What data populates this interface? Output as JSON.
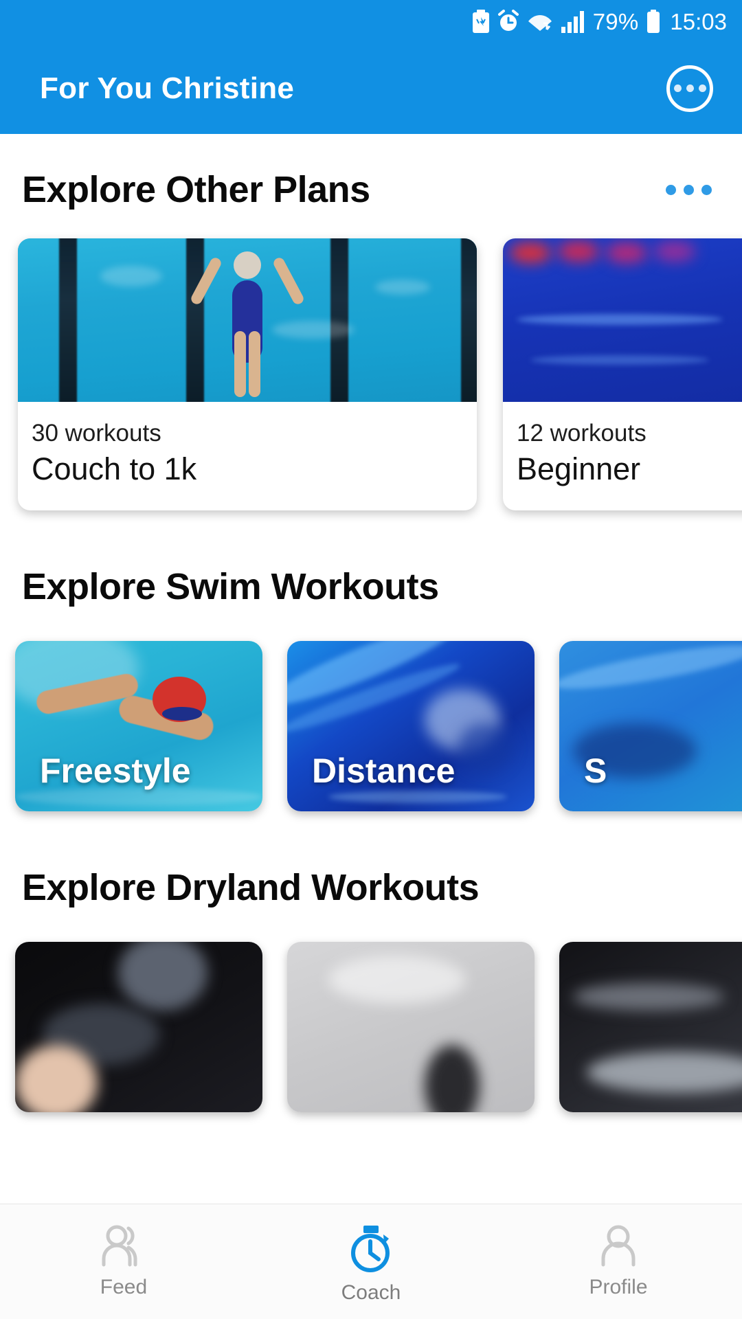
{
  "status_bar": {
    "battery_percent": "79%",
    "time": "15:03",
    "icons": [
      "battery-saver-icon",
      "alarm-icon",
      "wifi-icon",
      "signal-icon",
      "battery-icon"
    ]
  },
  "app_bar": {
    "title": "For You Christine",
    "overflow_icon": "overflow-menu-icon"
  },
  "colors": {
    "brand_blue": "#1190e3",
    "accent_blue": "#2f9be6",
    "nav_inactive": "#8a8a8a"
  },
  "sections": [
    {
      "id": "explore-other-plans",
      "title": "Explore Other Plans",
      "has_more_menu": true,
      "cards": [
        {
          "workouts": "30 workouts",
          "name": "Couch to 1k"
        },
        {
          "workouts": "12 workouts",
          "name": "Beginner"
        }
      ]
    },
    {
      "id": "explore-swim-workouts",
      "title": "Explore Swim Workouts",
      "has_more_menu": false,
      "tiles": [
        {
          "label": "Freestyle"
        },
        {
          "label": "Distance"
        },
        {
          "label": "S"
        }
      ]
    },
    {
      "id": "explore-dryland-workouts",
      "title": "Explore Dryland Workouts",
      "has_more_menu": false,
      "tiles": [
        {
          "label": ""
        },
        {
          "label": ""
        },
        {
          "label": ""
        }
      ]
    }
  ],
  "bottom_nav": {
    "items": [
      {
        "label": "Feed",
        "icon": "people-icon",
        "active": false
      },
      {
        "label": "Coach",
        "icon": "stopwatch-icon",
        "active": true
      },
      {
        "label": "Profile",
        "icon": "person-icon",
        "active": false
      }
    ]
  }
}
